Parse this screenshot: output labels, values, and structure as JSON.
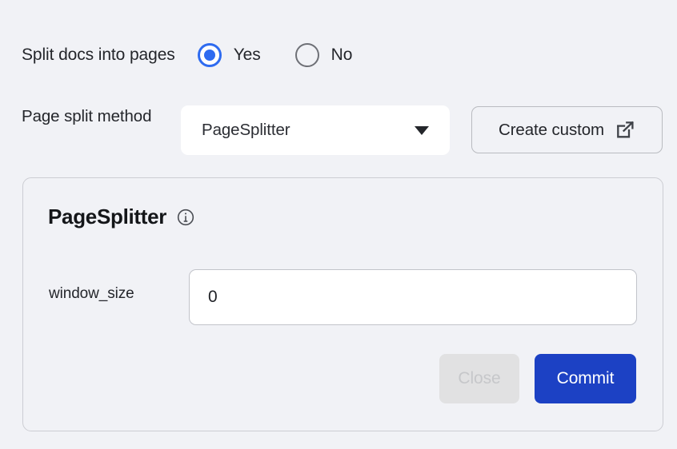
{
  "theme": {
    "page_bg": "#f1f2f6",
    "accent_blue": "#2e6bf0",
    "primary_button_blue": "#1c41c4",
    "card_border": "#cccdd3",
    "text": "#24262b",
    "disabled_bg": "#e1e1e2",
    "disabled_text": "#c6c7ca"
  },
  "split_docs": {
    "label": "Split docs into pages",
    "options": [
      {
        "label": "Yes",
        "value": "yes",
        "selected": true
      },
      {
        "label": "No",
        "value": "no",
        "selected": false
      }
    ]
  },
  "page_split_method": {
    "label": "Page split method",
    "selected_value": "PageSplitter",
    "dropdown_icon": "chevron-down-icon",
    "create_custom": {
      "label": "Create custom",
      "icon": "external-link-icon"
    }
  },
  "config_card": {
    "title": "PageSplitter",
    "title_icon": "info-icon",
    "fields": [
      {
        "name": "window_size",
        "label": "window_size",
        "value": "0",
        "placeholder": ""
      }
    ],
    "actions": {
      "close_label": "Close",
      "close_disabled": true,
      "commit_label": "Commit"
    }
  }
}
